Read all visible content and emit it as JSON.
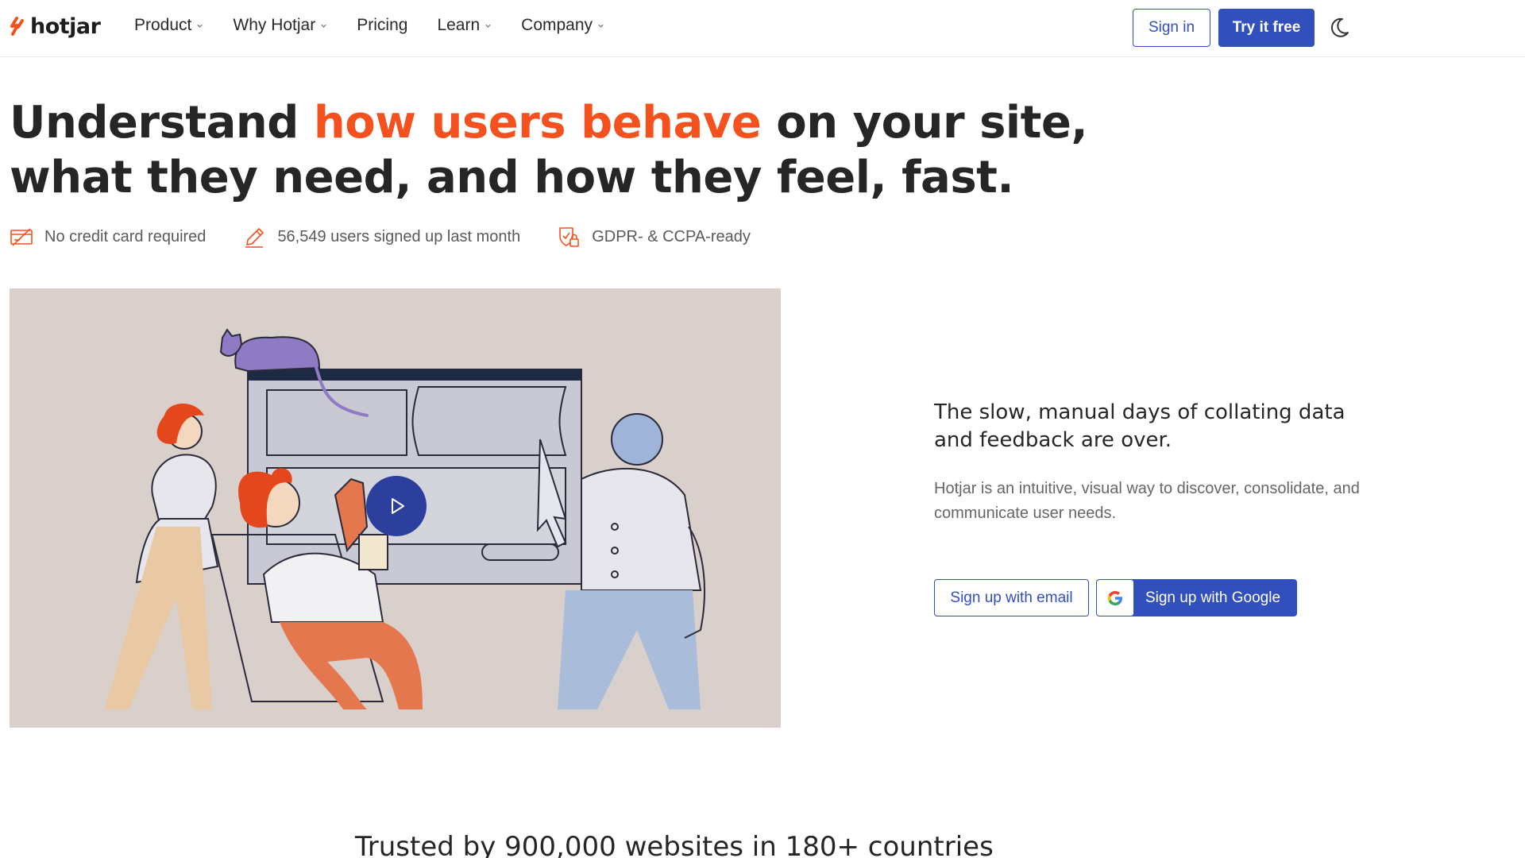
{
  "header": {
    "logo_text": "hotjar",
    "nav": [
      {
        "label": "Product",
        "has_dropdown": true
      },
      {
        "label": "Why Hotjar",
        "has_dropdown": true
      },
      {
        "label": "Pricing",
        "has_dropdown": false
      },
      {
        "label": "Learn",
        "has_dropdown": true
      },
      {
        "label": "Company",
        "has_dropdown": true
      }
    ],
    "sign_in": "Sign in",
    "try_free": "Try it free",
    "theme_icon": "moon-icon"
  },
  "hero": {
    "title_before": "Understand ",
    "title_highlight": "how users behave",
    "title_after": " on your site, what they need, and how they feel, fast.",
    "badges": [
      {
        "icon": "credit-card-icon",
        "text": "No credit card required"
      },
      {
        "icon": "pencil-icon",
        "text": "56,549 users signed up last month"
      },
      {
        "icon": "shield-lock-icon",
        "text": "GDPR- & CCPA-ready"
      }
    ]
  },
  "side": {
    "title": "The slow, manual days of collating data and feedback are over.",
    "description": "Hotjar is an intuitive, visual way to discover, consolidate, and communicate user needs.",
    "signup_email": "Sign up with email",
    "signup_google": "Sign up with Google"
  },
  "trusted": "Trusted by 900,000 websites in 180+ countries",
  "colors": {
    "accent": "#f4511e",
    "primary": "#324fbe",
    "illustration_bg": "#dad0cb"
  }
}
